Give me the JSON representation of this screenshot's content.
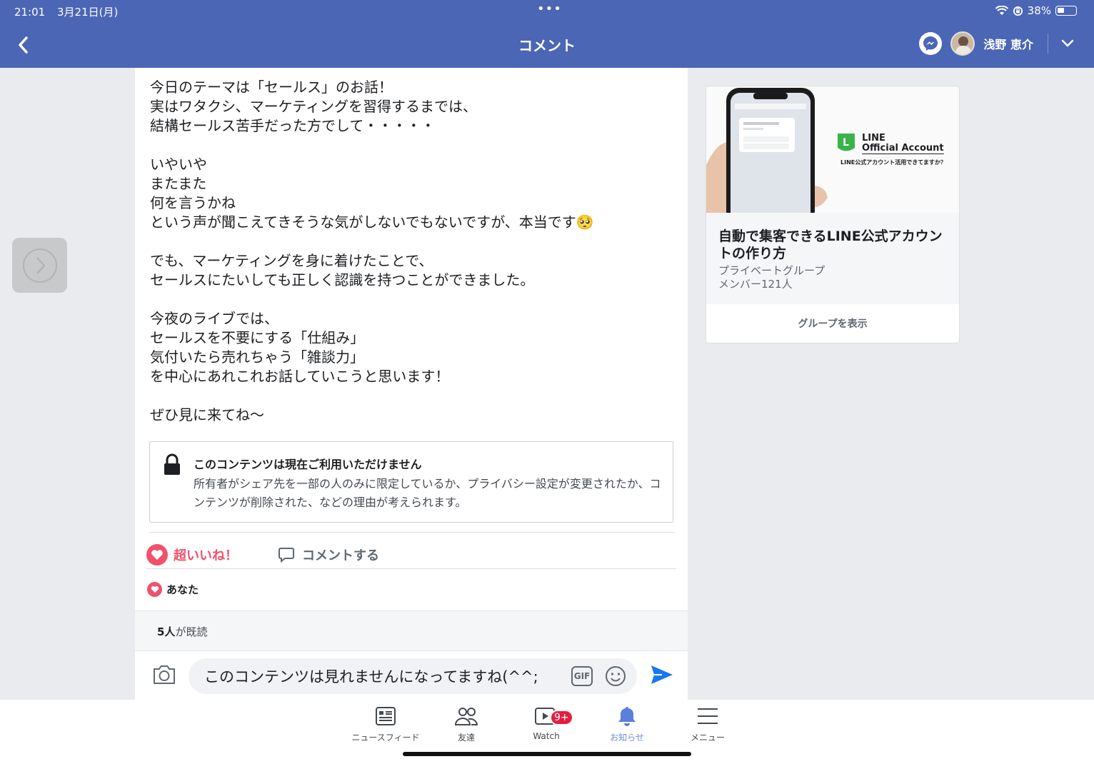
{
  "status_bar": {
    "time": "21:01",
    "date": "3月21日(月)",
    "battery": "38%"
  },
  "nav": {
    "title": "コメント",
    "user_name": "浅野 恵介"
  },
  "post": {
    "body": "今日のテーマは「セールス」のお話！\n実はワタクシ、マーケティングを習得するまでは、\n結構セールス苦手だった方でして・・・・・\n\nいやいや\nまたまた\n何を言うかね\nという声が聞こえてきそうな気がしないでもないですが、本当です🥺\n\nでも、マーケティングを身に着けたことで、\nセールスにたいしても正しく認識を持つことができました。\n\n今夜のライブでは、\nセールスを不要にする「仕組み」\n気付いたら売れちゃう「雑談力」\nを中心にあれこれお話していこうと思います！\n\nぜひ見に来てね〜",
    "unavailable_title": "このコンテンツは現在ご利用いただけません",
    "unavailable_desc": "所有者がシェア先を一部の人のみに限定しているか、プライバシー設定が変更されたか、コンテンツが削除された、などの理由が考えられます。",
    "love_label": "超いいね！",
    "comment_label": "コメントする",
    "reactors": "あなた",
    "seen_count": "5人",
    "seen_suffix": "が既読"
  },
  "composer": {
    "value": "このコンテンツは見れませんになってますね(^^;",
    "gif_label": "GIF"
  },
  "group": {
    "cover_brand": "LINE",
    "cover_brand_sub": "Official Account",
    "cover_tagline": "LINE公式アカウント活用できてますか？",
    "title": "自動で集客できるLINE公式アカウントの作り方",
    "privacy": "プライベートグループ",
    "members": "メンバー121人",
    "view_button": "グループを表示"
  },
  "tabs": [
    {
      "label": "ニュースフィード",
      "icon": "newsfeed-icon"
    },
    {
      "label": "友達",
      "icon": "friends-icon"
    },
    {
      "label": "Watch",
      "icon": "watch-icon",
      "badge": "9+"
    },
    {
      "label": "お知らせ",
      "icon": "bell-icon",
      "active": true
    },
    {
      "label": "メニュー",
      "icon": "menu-icon"
    }
  ],
  "colors": {
    "brand_blue": "#4b66b5",
    "love_pink": "#f0516d",
    "send_blue": "#1877f2",
    "badge_red": "#e41e3f"
  }
}
